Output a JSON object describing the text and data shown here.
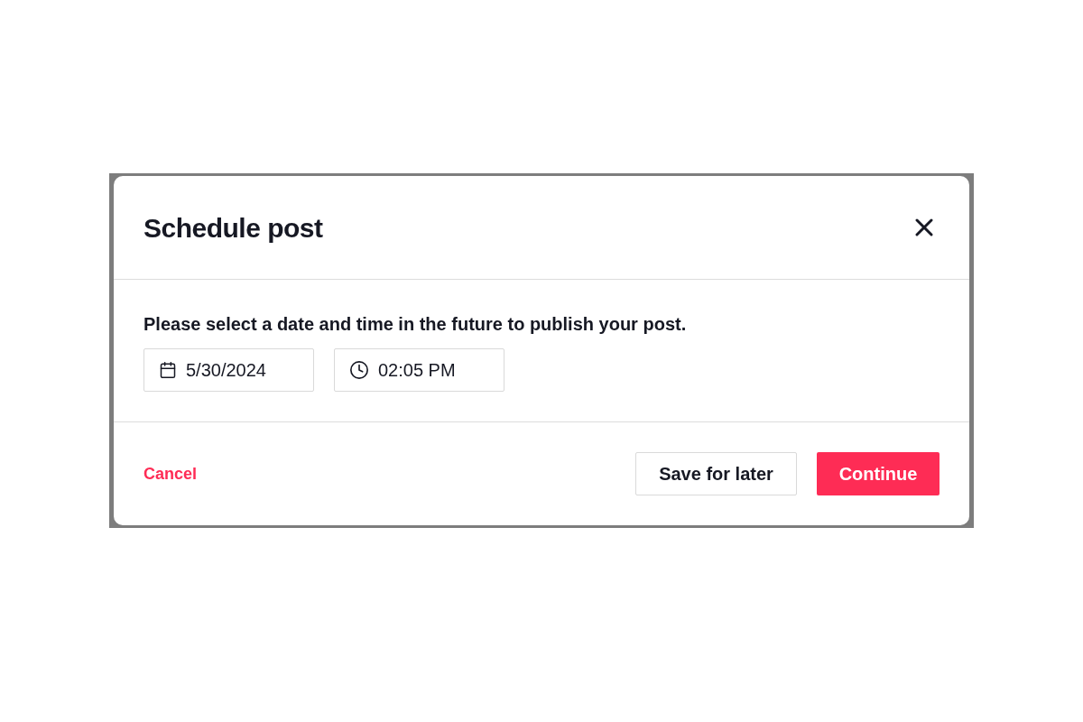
{
  "dialog": {
    "title": "Schedule post",
    "message": "Please select a date and time in the future to publish your post.",
    "fields": [
      {
        "kind": "date",
        "value": "5/30/2024"
      },
      {
        "kind": "time",
        "value": "02:05 PM"
      }
    ],
    "cancel": "Cancel",
    "save": "Save for later",
    "continue": "Continue"
  }
}
